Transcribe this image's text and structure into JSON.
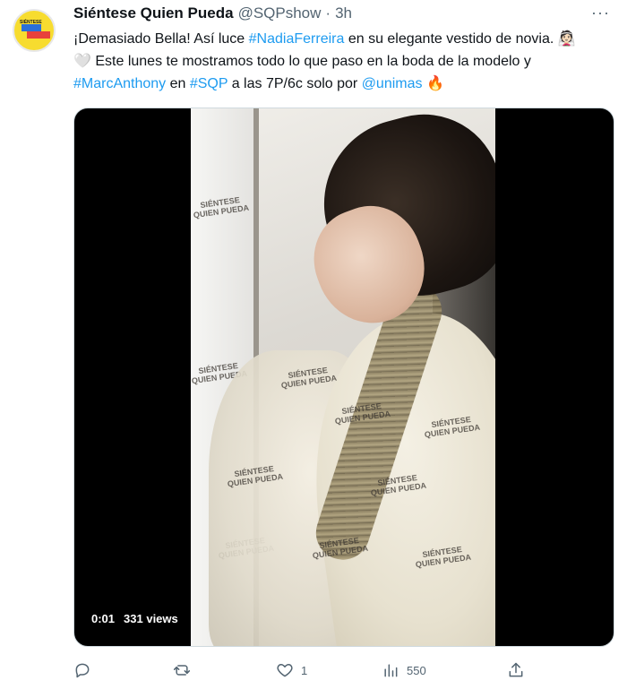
{
  "tweet": {
    "author_name": "Siéntese Quien Pueda",
    "handle": "@SQPshow",
    "separator": "·",
    "time": "3h",
    "more": "···",
    "text_parts": {
      "p1": "¡Demasiado Bella! Así luce ",
      "tag1": "#NadiaFerreira",
      "p2": " en su elegante vestido de novia. 👰🏻🤍 Este lunes te mostramos todo lo que paso en la boda de la modelo y ",
      "tag2": "#MarcAnthony",
      "p3": " en ",
      "tag3": "#SQP",
      "p4": " a las 7P/6c solo por ",
      "tag4": "@unimas",
      "p5": " 🔥"
    },
    "avatar_text": "SIÉNTESE"
  },
  "video": {
    "elapsed": "0:01",
    "views": "331 views",
    "backdrop_logo": "Siéntese Quien Pueda"
  },
  "actions": {
    "reply_count": "",
    "retweet_count": "",
    "like_count": "1",
    "views_count": "550"
  },
  "icons": [
    "reply-icon",
    "retweet-icon",
    "like-icon",
    "views-icon",
    "share-icon",
    "more-icon"
  ],
  "colors": {
    "link": "#1d9bf0",
    "muted": "#536471",
    "text": "#0f1419"
  }
}
